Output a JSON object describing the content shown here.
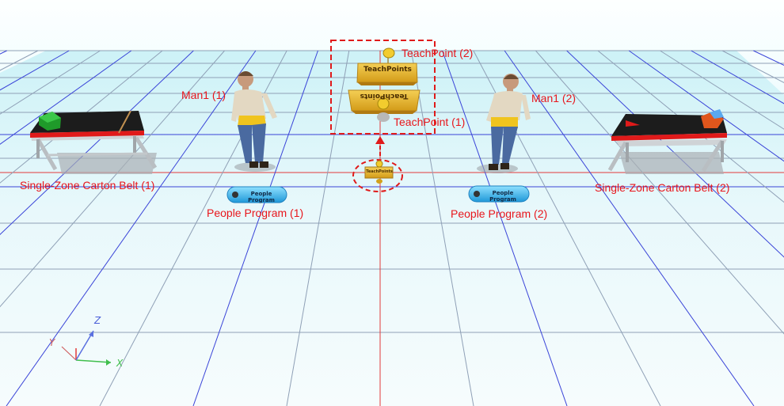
{
  "scene": {
    "labels": {
      "teachpoint_2": "TeachPoint (2)",
      "teachpoint_1": "TeachPoint (1)",
      "man1_1": "Man1 (1)",
      "man1_2": "Man1 (2)",
      "belt_1": "Single-Zone Carton Belt (1)",
      "belt_2": "Single-Zone Carton Belt (2)",
      "people_program_1": "People Program (1)",
      "people_program_2": "People Program (2)"
    },
    "objects": {
      "teachpoints_block_label": "TeachPoints",
      "teachpoints_block_mirrored_label": "TeachPoints",
      "people_program_button_label": "People Program",
      "small_teachpoints_label": "TeachPoints"
    },
    "axes": {
      "x": "X",
      "y": "Y",
      "z": "Z"
    },
    "colors": {
      "grid_blue": "#3a44d8",
      "grid_gray": "#8fa0b6",
      "axis_red": "#e23a3a",
      "label_red": "#e8161c",
      "block_gold": "#e2b52c",
      "program_blue": "#38b4ec",
      "belt_red": "#e01a1a"
    }
  }
}
